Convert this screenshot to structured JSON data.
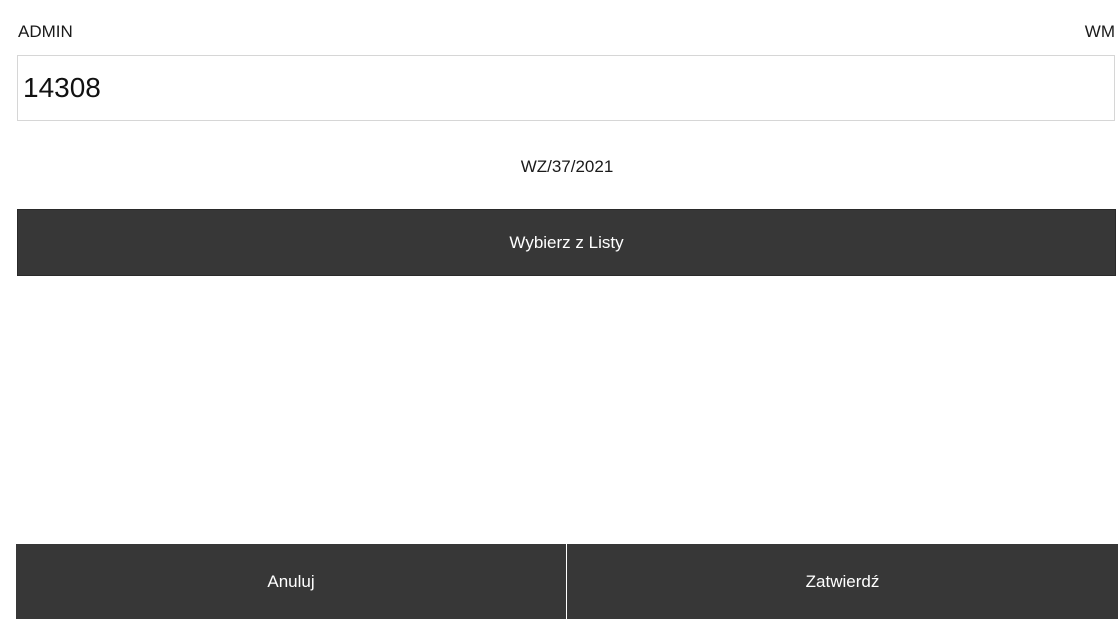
{
  "header": {
    "user_label": "ADMIN",
    "module_label": "WM"
  },
  "scan_input": {
    "value": "14308",
    "placeholder": ""
  },
  "document": {
    "number": "WZ/37/2021"
  },
  "actions": {
    "select_from_list_label": "Wybierz z Listy",
    "cancel_label": "Anuluj",
    "confirm_label": "Zatwierdź"
  },
  "colors": {
    "button_background": "#373737",
    "button_text": "#ffffff",
    "input_border": "#d6d6d6"
  }
}
